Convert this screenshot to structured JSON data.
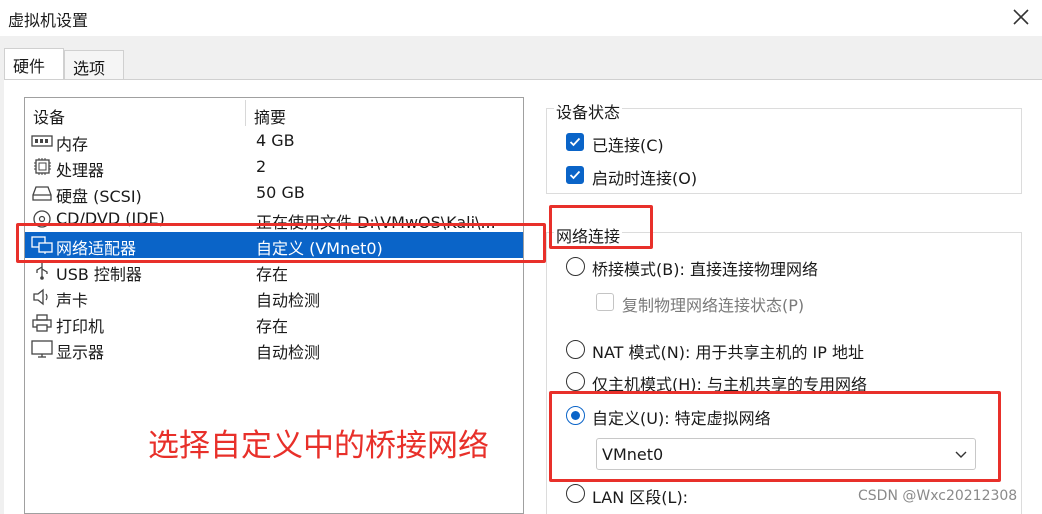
{
  "window": {
    "title": "虚拟机设置"
  },
  "tabs": [
    {
      "label": "硬件",
      "active": true
    },
    {
      "label": "选项",
      "active": false
    }
  ],
  "device_list": {
    "headers": {
      "device": "设备",
      "summary": "摘要"
    },
    "rows": [
      {
        "icon": "memory-icon",
        "name": "内存",
        "summary": "4 GB"
      },
      {
        "icon": "processor-icon",
        "name": "处理器",
        "summary": "2"
      },
      {
        "icon": "harddisk-icon",
        "name": "硬盘 (SCSI)",
        "summary": "50 GB"
      },
      {
        "icon": "cd-dvd-icon",
        "name": "CD/DVD (IDE)",
        "summary": "正在使用文件 D:\\VMwOS\\Kali\\..."
      },
      {
        "icon": "network-adapter-icon",
        "name": "网络适配器",
        "summary": "自定义 (VMnet0)",
        "selected": true
      },
      {
        "icon": "usb-icon",
        "name": "USB 控制器",
        "summary": "存在"
      },
      {
        "icon": "speaker-icon",
        "name": "声卡",
        "summary": "自动检测"
      },
      {
        "icon": "printer-icon",
        "name": "打印机",
        "summary": "存在"
      },
      {
        "icon": "monitor-icon",
        "name": "显示器",
        "summary": "自动检测"
      }
    ]
  },
  "device_status": {
    "title": "设备状态",
    "connected": {
      "label": "已连接(C)",
      "checked": true
    },
    "connect_at_power_on": {
      "label": "启动时连接(O)",
      "checked": true
    }
  },
  "network_connection": {
    "title": "网络连接",
    "options": [
      {
        "label": "桥接模式(B): 直接连接物理网络",
        "selected": false
      },
      {
        "label": "复制物理网络连接状态(P)",
        "type": "checkbox",
        "checked": false,
        "disabled": true
      },
      {
        "label": "NAT 模式(N): 用于共享主机的 IP 地址",
        "selected": false
      },
      {
        "label": "仅主机模式(H): 与主机共享的专用网络",
        "selected": false
      },
      {
        "label": "自定义(U): 特定虚拟网络",
        "selected": true
      },
      {
        "label": "LAN 区段(L):",
        "selected": false
      }
    ],
    "custom_network_value": "VMnet0"
  },
  "annotation": {
    "text": "选择自定义中的桥接网络",
    "color": "#e8302a"
  },
  "watermark": {
    "text": "CSDN @Wxc20212308"
  },
  "colors": {
    "accent": "#0a64c8",
    "annotation_red": "#e8302a"
  }
}
